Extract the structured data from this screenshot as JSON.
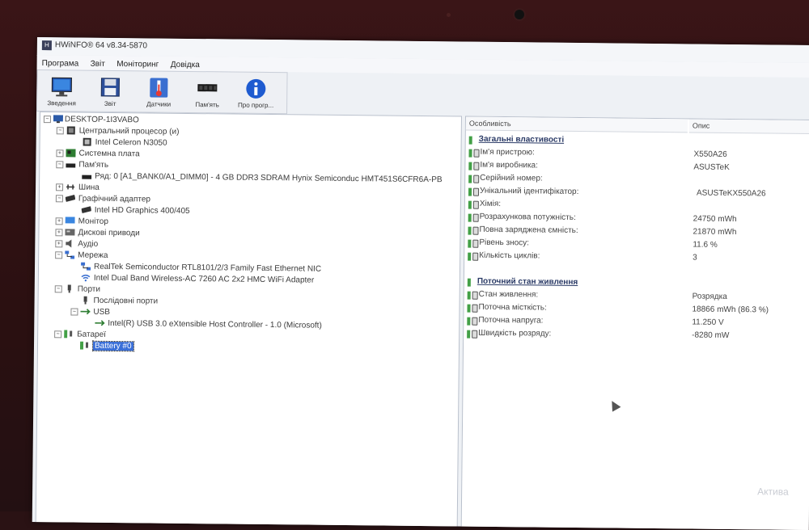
{
  "window": {
    "title": "HWiNFO® 64 v8.34-5870"
  },
  "menu": [
    "Програма",
    "Звіт",
    "Моніторинг",
    "Довідка"
  ],
  "toolbar": [
    {
      "label": "Зведення",
      "icon": "monitor-icon"
    },
    {
      "label": "Звіт",
      "icon": "floppy-icon"
    },
    {
      "label": "Датчики",
      "icon": "thermometer-icon"
    },
    {
      "label": "Пам'ять",
      "icon": "memory-chip-icon"
    },
    {
      "label": "Про прогр...",
      "icon": "info-icon"
    }
  ],
  "tree": [
    "DESKTOP-1I3VABO",
    "Центральний процесор (и)",
    "Intel Celeron N3050",
    "Системна плата",
    "Пам'ять",
    "Ряд: 0 [A1_BANK0/A1_DIMM0] - 4 GB DDR3 SDRAM Hynix Semiconduc HMT451S6CFR6A-PB",
    "Шина",
    "Графічний адаптер",
    "Intel HD Graphics 400/405",
    "Монітор",
    "Дискові приводи",
    "Аудіо",
    "Мережа",
    "RealTek Semiconductor RTL8101/2/3 Family Fast Ethernet NIC",
    "Intel Dual Band Wireless-AC 7260 AC 2x2 HMC WiFi Adapter",
    "Порти",
    "Послідовні порти",
    "USB",
    "Intel(R) USB 3.0 eXtensible Host Controller - 1.0 (Microsoft)",
    "Батареї",
    "Battery #0"
  ],
  "details": {
    "col_feature": "Особливість",
    "col_desc": "Опис",
    "section1": "Загальні властивості",
    "props1": [
      {
        "k": "Ім'я пристрою:",
        "v": "X550A26"
      },
      {
        "k": "Ім'я виробника:",
        "v": "ASUSTeK"
      },
      {
        "k": "Серійний номер:",
        "v": ""
      },
      {
        "k": "Унікальний ідентифікатор:",
        "v": "ASUSTeKX550A26"
      },
      {
        "k": "Хімія:",
        "v": ""
      },
      {
        "k": "Розрахункова потужність:",
        "v": "24750 mWh"
      },
      {
        "k": "Повна заряджена ємність:",
        "v": "21870 mWh"
      },
      {
        "k": "Рівень зносу:",
        "v": "11.6 %"
      },
      {
        "k": "Кількість циклів:",
        "v": "3"
      }
    ],
    "section2": "Поточний стан живлення",
    "props2": [
      {
        "k": "Стан живлення:",
        "v": "Розрядка"
      },
      {
        "k": "Поточна місткість:",
        "v": "18866 mWh (86.3 %)"
      },
      {
        "k": "Поточна напруга:",
        "v": "11.250 V"
      },
      {
        "k": "Швидкість розряду:",
        "v": "-8280 mW"
      }
    ]
  },
  "watermark": "Актива"
}
